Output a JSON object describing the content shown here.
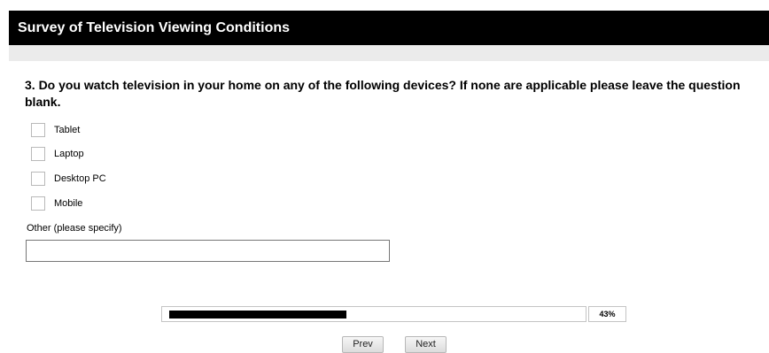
{
  "header": {
    "title": "Survey of Television Viewing Conditions"
  },
  "question": {
    "text": "3. Do you watch television in your home on any of the following devices? If none are applicable please leave the question blank.",
    "options": [
      {
        "label": "Tablet",
        "checked": false
      },
      {
        "label": "Laptop",
        "checked": false
      },
      {
        "label": "Desktop PC",
        "checked": false
      },
      {
        "label": "Mobile",
        "checked": false
      }
    ],
    "other_label": "Other (please specify)",
    "other_value": ""
  },
  "progress": {
    "percent_label": "43%",
    "fraction": 0.43
  },
  "nav": {
    "prev_label": "Prev",
    "next_label": "Next"
  }
}
